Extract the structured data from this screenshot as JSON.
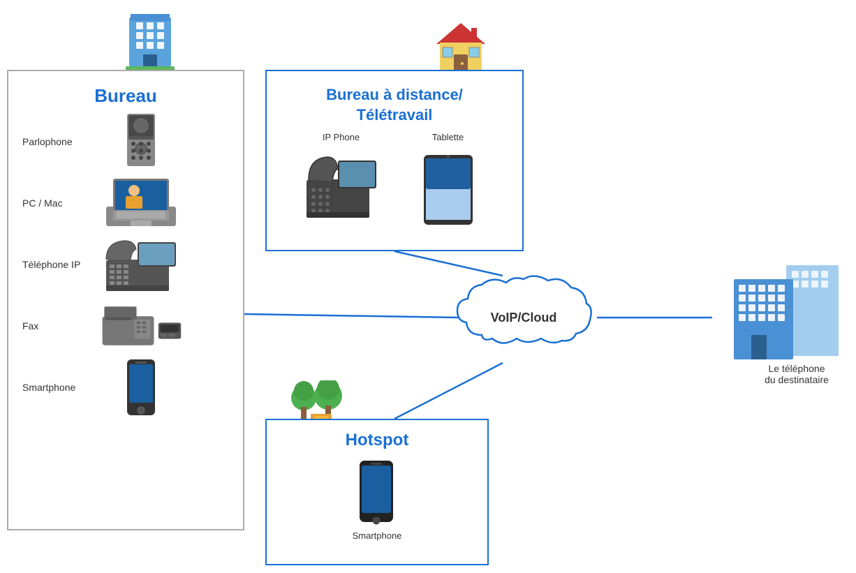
{
  "bureau": {
    "title": "Bureau",
    "items": [
      {
        "label": "Parlophone",
        "icon": "parlophone"
      },
      {
        "label": "PC / Mac",
        "icon": "pc-mac"
      },
      {
        "label": "Téléphone IP",
        "icon": "telephone-ip"
      },
      {
        "label": "Fax",
        "icon": "fax"
      },
      {
        "label": "Smartphone",
        "icon": "smartphone"
      }
    ]
  },
  "remote": {
    "title_line1": "Bureau à distance/",
    "title_line2": "Télétravail",
    "items": [
      {
        "label": "IP Phone",
        "icon": "ip-phone"
      },
      {
        "label": "Tablette",
        "icon": "tablette"
      }
    ]
  },
  "hotspot": {
    "title": "Hotspot",
    "items": [
      {
        "label": "Smartphone",
        "icon": "smartphone"
      }
    ]
  },
  "voip": {
    "label": "VoIP/Cloud"
  },
  "destination": {
    "label": "Le téléphone\ndu destinataire"
  }
}
